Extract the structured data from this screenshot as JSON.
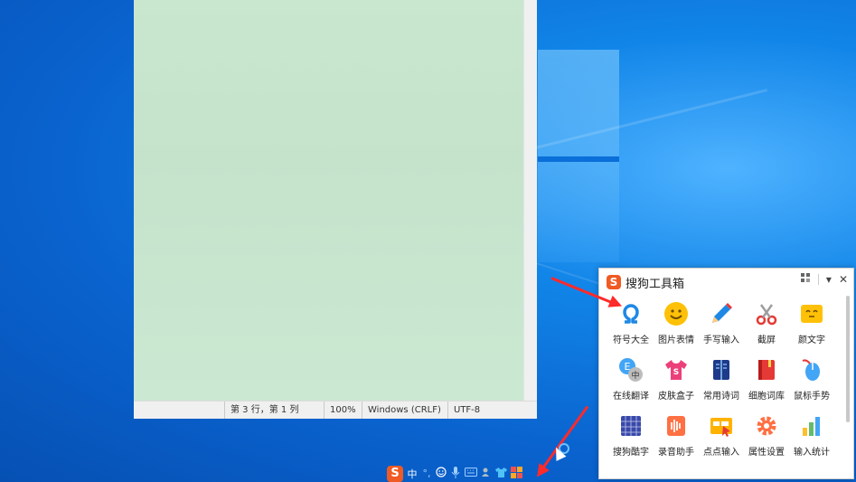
{
  "notepad": {
    "status": {
      "position": "第 3 行，第 1 列",
      "zoom": "100%",
      "line_ending": "Windows (CRLF)",
      "encoding": "UTF-8"
    }
  },
  "toolbox": {
    "title": "搜狗工具箱",
    "logo_letter": "S",
    "close": "✕",
    "dropdown": "▾",
    "tools": [
      {
        "label": "符号大全",
        "icon": "omega-icon"
      },
      {
        "label": "图片表情",
        "icon": "smiley-icon"
      },
      {
        "label": "手写输入",
        "icon": "pencil-icon"
      },
      {
        "label": "截屏",
        "icon": "scissors-icon"
      },
      {
        "label": "颜文字",
        "icon": "kaomoji-icon"
      },
      {
        "label": "在线翻译",
        "icon": "translate-icon"
      },
      {
        "label": "皮肤盒子",
        "icon": "shirt-icon"
      },
      {
        "label": "常用诗词",
        "icon": "book-icon"
      },
      {
        "label": "细胞词库",
        "icon": "red-book-icon"
      },
      {
        "label": "鼠标手势",
        "icon": "mouse-icon"
      },
      {
        "label": "搜狗酷字",
        "icon": "grid-text-icon"
      },
      {
        "label": "录音助手",
        "icon": "voice-wave-icon"
      },
      {
        "label": "点点输入",
        "icon": "click-input-icon"
      },
      {
        "label": "属性设置",
        "icon": "gear-icon"
      },
      {
        "label": "输入统计",
        "icon": "bar-stats-icon"
      }
    ]
  },
  "ime": {
    "logo_letter": "S",
    "mode": "中",
    "punct": "°,",
    "colors": {
      "accent": "#f05a23"
    }
  }
}
